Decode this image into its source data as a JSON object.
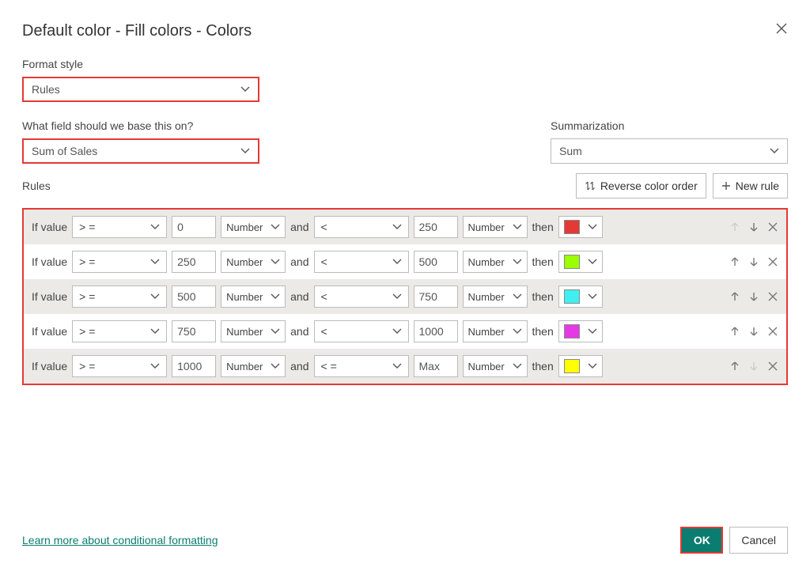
{
  "title": "Default color - Fill colors - Colors",
  "labels": {
    "format_style": "Format style",
    "base_field": "What field should we base this on?",
    "summarization": "Summarization",
    "rules": "Rules",
    "reverse": "Reverse color order",
    "new_rule": "New rule",
    "if_value": "If value",
    "and": "and",
    "then": "then",
    "learn_more": "Learn more about conditional formatting",
    "ok": "OK",
    "cancel": "Cancel"
  },
  "dropdowns": {
    "format_style": "Rules",
    "base_field": "Sum of Sales",
    "summarization": "Sum"
  },
  "rules": [
    {
      "op1": "> =",
      "val1": "0",
      "type1": "Number",
      "op2": "<",
      "val2": "250",
      "type2": "Number",
      "color": "#e53935",
      "upDisabled": true,
      "downDisabled": false
    },
    {
      "op1": "> =",
      "val1": "250",
      "type1": "Number",
      "op2": "<",
      "val2": "500",
      "type2": "Number",
      "color": "#9bff00",
      "upDisabled": false,
      "downDisabled": false
    },
    {
      "op1": "> =",
      "val1": "500",
      "type1": "Number",
      "op2": "<",
      "val2": "750",
      "type2": "Number",
      "color": "#40f0f0",
      "upDisabled": false,
      "downDisabled": false
    },
    {
      "op1": "> =",
      "val1": "750",
      "type1": "Number",
      "op2": "<",
      "val2": "1000",
      "type2": "Number",
      "color": "#e639e6",
      "upDisabled": false,
      "downDisabled": false
    },
    {
      "op1": "> =",
      "val1": "1000",
      "type1": "Number",
      "op2": "< =",
      "val2": "Max",
      "type2": "Number",
      "color": "#ffff00",
      "upDisabled": false,
      "downDisabled": true
    }
  ]
}
